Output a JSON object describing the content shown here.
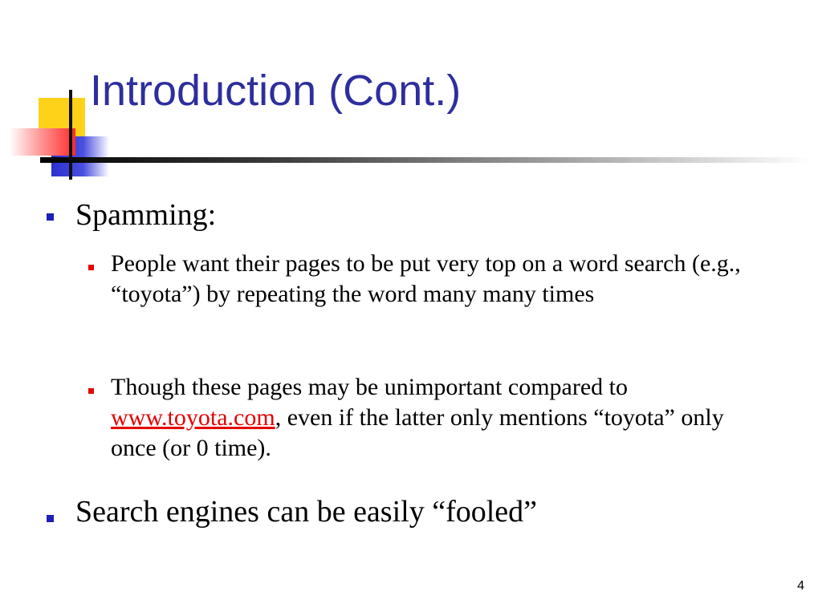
{
  "slide": {
    "title": "Introduction (Cont.)",
    "bullets": [
      {
        "text": "Spamming:",
        "sub": [
          {
            "text": "People want their pages to be put very top on a word search (e.g., “toyota”) by repeating the word many many times"
          },
          {
            "before": "Though these pages may be unimportant compared to ",
            "link": "www.toyota.com",
            "after": ", even if the latter only mentions “toyota” only once (or 0 time)."
          }
        ]
      },
      {
        "text": "Search engines can be easily “fooled”"
      }
    ],
    "page_number": "4"
  },
  "colors": {
    "title": "#2e2e9e",
    "bullet_level1": "#1f1fb8",
    "bullet_level2": "#e60000",
    "link": "#e60000"
  }
}
